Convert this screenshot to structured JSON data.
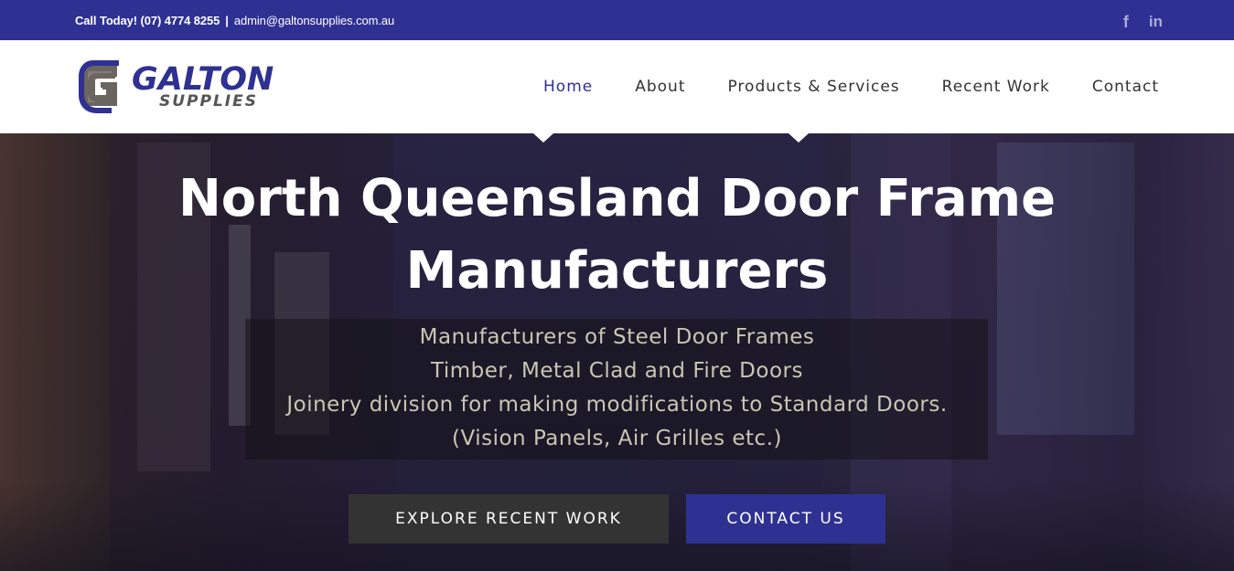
{
  "topbar": {
    "phone": "Call Today! (07) 4774 8255",
    "separator": "|",
    "email": "admin@galtonsupplies.com.au",
    "social": [
      {
        "icon": "facebook-icon",
        "glyph": "f"
      },
      {
        "icon": "linkedin-icon",
        "glyph": "in"
      }
    ]
  },
  "logo": {
    "name": "GALTON",
    "tagline": "SUPPLIES"
  },
  "nav": {
    "items": [
      {
        "label": "Home",
        "active": true
      },
      {
        "label": "About",
        "active": false
      },
      {
        "label": "Products & Services",
        "active": false
      },
      {
        "label": "Recent Work",
        "active": false
      },
      {
        "label": "Contact",
        "active": false
      }
    ]
  },
  "hero": {
    "title_line1": "North Queensland Door Frame",
    "title_line2": "Manufacturers",
    "subtitle_lines": [
      "Manufacturers of Steel Door Frames",
      "Timber, Metal Clad and Fire Doors",
      "Joinery division for making modifications to Standard Doors.",
      "(Vision Panels, Air Grilles etc.)"
    ],
    "explore_button": "EXPLORE RECENT WORK",
    "contact_button": "CONTACT US"
  },
  "colors": {
    "brand_blue": "#2e3192",
    "dark_button": "#333333",
    "header_bg": "#ffffff"
  }
}
